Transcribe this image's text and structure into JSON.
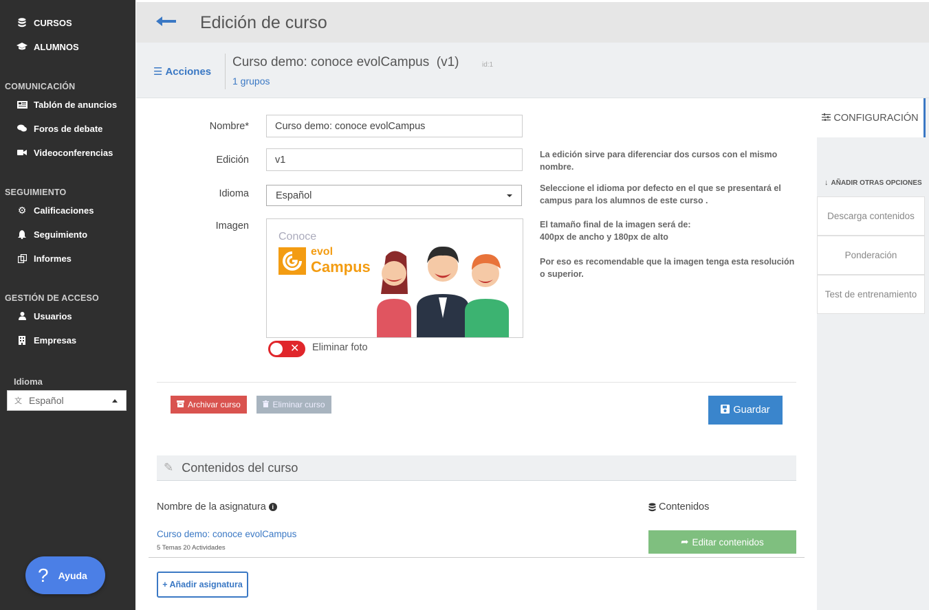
{
  "sidebar": {
    "items": [
      {
        "label": "CURSOS",
        "icon": "database-icon"
      },
      {
        "label": "ALUMNOS",
        "icon": "graduation-cap-icon"
      }
    ],
    "sections": [
      {
        "title": "COMUNICACIÓN",
        "items": [
          {
            "label": "Tablón de anuncios",
            "icon": "newspaper-icon"
          },
          {
            "label": "Foros de debate",
            "icon": "comments-icon"
          },
          {
            "label": "Videoconferencias",
            "icon": "video-camera-icon"
          }
        ]
      },
      {
        "title": "SEGUIMIENTO",
        "items": [
          {
            "label": "Calificaciones",
            "icon": "gear-icon"
          },
          {
            "label": "Seguimiento",
            "icon": "bell-icon"
          },
          {
            "label": "Informes",
            "icon": "report-icon"
          }
        ]
      },
      {
        "title": "GESTIÓN DE ACCESO",
        "items": [
          {
            "label": "Usuarios",
            "icon": "user-icon"
          },
          {
            "label": "Empresas",
            "icon": "building-icon"
          }
        ]
      }
    ],
    "language_label": "Idioma",
    "language_value": "Español",
    "help_label": "Ayuda"
  },
  "header": {
    "title": "Edición de curso",
    "actions_label": "Acciones",
    "course_title": "Curso demo: conoce evolCampus  (v1)",
    "course_id": "id:1",
    "groups_link": "1 grupos"
  },
  "form": {
    "name_label": "Nombre*",
    "name_value": "Curso demo: conoce evolCampus",
    "edition_label": "Edición",
    "edition_value": "v1",
    "edition_help": "La edición sirve para diferenciar dos cursos con el mismo nombre.",
    "language_label": "Idioma",
    "language_value": "Español",
    "language_help": "Seleccione el idioma por defecto en el que se presentará el campus para los alumnos de este curso .",
    "image_label": "Imagen",
    "image_help_1": "El tamaño final de la imagen será de:",
    "image_help_2": "400px de ancho y 180px de alto",
    "image_help_3": "Por eso es recomendable que la imagen tenga esta resolución o superior.",
    "image_logo_top": "Conoce",
    "image_logo_evol": "evol",
    "image_logo_campus": "Campus",
    "remove_photo_label": "Eliminar foto",
    "archive_button": "Archivar curso",
    "delete_button": "Eliminar curso",
    "save_button": "Guardar"
  },
  "contents": {
    "title": "Contenidos del curso",
    "col_subject": "Nombre de la asignatura",
    "col_contents": "Contenidos",
    "rows": [
      {
        "name": "Curso demo: conoce evolCampus",
        "meta": "5 Temas 20 Actividades",
        "action": "Editar contenidos"
      }
    ],
    "add_button": "+ Añadir asignatura"
  },
  "right_panel": {
    "active_tab": "CONFIGURACIÓN",
    "more_options": "AÑADIR OTRAS OPCIONES",
    "items": [
      "Descarga contenidos",
      "Ponderación",
      "Test de entrenamiento"
    ]
  },
  "colors": {
    "accent": "#3a78c4",
    "sidebar_bg": "#2f2f2f",
    "danger": "#d9534f",
    "success": "#7fbf7f",
    "help_button": "#4b7fe6"
  }
}
